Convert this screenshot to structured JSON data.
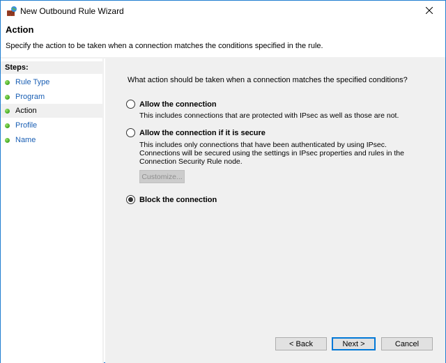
{
  "window": {
    "title": "New Outbound Rule Wizard",
    "close_icon": "close-x-icon",
    "app_icon": "firewall-globe-icon"
  },
  "header": {
    "title": "Action",
    "description": "Specify the action to be taken when a connection matches the conditions specified in the rule."
  },
  "steps": {
    "heading": "Steps:",
    "items": [
      {
        "label": "Rule Type",
        "current": false
      },
      {
        "label": "Program",
        "current": false
      },
      {
        "label": "Action",
        "current": true
      },
      {
        "label": "Profile",
        "current": false
      },
      {
        "label": "Name",
        "current": false
      }
    ]
  },
  "main": {
    "question": "What action should be taken when a connection matches the specified conditions?",
    "options": [
      {
        "label": "Allow the connection",
        "description": "This includes connections that are protected with IPsec as well as those are not.",
        "selected": false
      },
      {
        "label": "Allow the connection if it is secure",
        "description": "This includes only connections that have been authenticated by using IPsec.  Connections will be secured using the settings in IPsec properties and rules in the Connection Security Rule node.",
        "selected": false
      },
      {
        "label": "Block the connection",
        "description": "",
        "selected": true
      }
    ],
    "customize_label": "Customize..."
  },
  "buttons": {
    "back": "< Back",
    "next": "Next >",
    "cancel": "Cancel"
  }
}
